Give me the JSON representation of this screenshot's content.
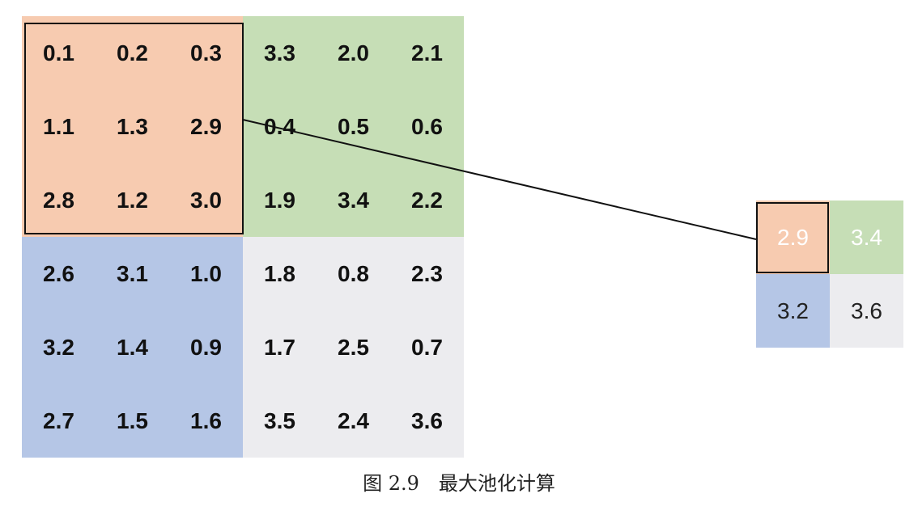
{
  "caption": "图 2.9　最大池化计算",
  "colors": {
    "top_left": "#f7cbb0",
    "top_right": "#c6deb6",
    "bottom_left": "#b5c6e6",
    "bottom_right": "#ececef"
  },
  "input_grid": [
    [
      "0.1",
      "0.2",
      "0.3",
      "3.3",
      "2.0",
      "2.1"
    ],
    [
      "1.1",
      "1.3",
      "2.9",
      "0.4",
      "0.5",
      "0.6"
    ],
    [
      "2.8",
      "1.2",
      "3.0",
      "1.9",
      "3.4",
      "2.2"
    ],
    [
      "2.6",
      "3.1",
      "1.0",
      "1.8",
      "0.8",
      "2.3"
    ],
    [
      "3.2",
      "1.4",
      "0.9",
      "1.7",
      "2.5",
      "0.7"
    ],
    [
      "2.7",
      "1.5",
      "1.6",
      "3.5",
      "2.4",
      "3.6"
    ]
  ],
  "output_grid": [
    [
      "2.9",
      "3.4"
    ],
    [
      "3.2",
      "3.6"
    ]
  ]
}
